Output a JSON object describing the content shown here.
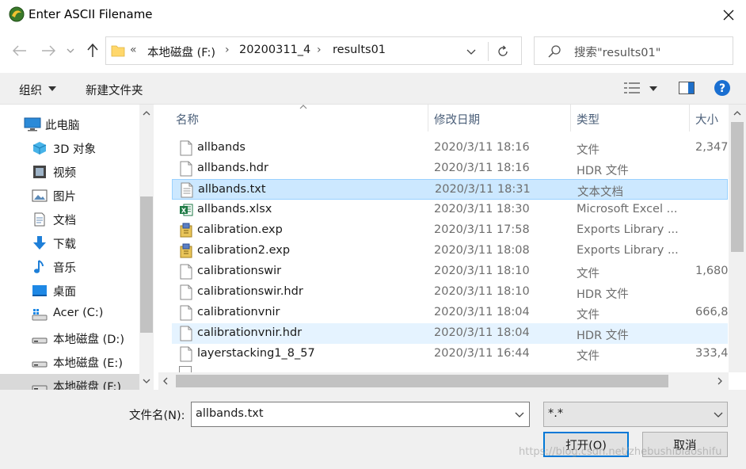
{
  "window": {
    "title": "Enter ASCII Filename",
    "close_icon": "close-icon",
    "app_icon": "idl-app-icon"
  },
  "address": {
    "overflow": "«",
    "crumbs": [
      "本地磁盘 (F:)",
      "20200311_4",
      "results01"
    ],
    "search_placeholder": "搜索\"results01\""
  },
  "toolbar": {
    "organize": "组织",
    "new_folder": "新建文件夹"
  },
  "nav": {
    "items": [
      {
        "label": "此电脑",
        "icon": "computer-icon"
      },
      {
        "label": "3D 对象",
        "icon": "cube-3d-icon"
      },
      {
        "label": "视频",
        "icon": "video-icon"
      },
      {
        "label": "图片",
        "icon": "picture-icon"
      },
      {
        "label": "文档",
        "icon": "document-icon"
      },
      {
        "label": "下载",
        "icon": "download-arrow-icon"
      },
      {
        "label": "音乐",
        "icon": "music-note-icon"
      },
      {
        "label": "桌面",
        "icon": "desktop-icon"
      },
      {
        "label": "Acer (C:)",
        "icon": "windows-drive-icon"
      },
      {
        "label": "本地磁盘 (D:)",
        "icon": "drive-icon"
      },
      {
        "label": "本地磁盘 (E:)",
        "icon": "drive-icon"
      },
      {
        "label": "本地磁盘 (F:)",
        "icon": "drive-icon"
      }
    ]
  },
  "columns": {
    "name": "名称",
    "date": "修改日期",
    "type": "类型",
    "size": "大小"
  },
  "files": [
    {
      "name": "allbands",
      "date": "2020/3/11 18:16",
      "type": "文件",
      "size": "2,347",
      "icon": "file-icon"
    },
    {
      "name": "allbands.hdr",
      "date": "2020/3/11 18:16",
      "type": "HDR 文件",
      "size": "",
      "icon": "file-icon"
    },
    {
      "name": "allbands.txt",
      "date": "2020/3/11 18:31",
      "type": "文本文档",
      "size": "",
      "icon": "text-file-icon"
    },
    {
      "name": "allbands.xlsx",
      "date": "2020/3/11 18:30",
      "type": "Microsoft Excel ...",
      "size": "",
      "icon": "excel-icon"
    },
    {
      "name": "calibration.exp",
      "date": "2020/3/11 17:58",
      "type": "Exports Library ...",
      "size": "",
      "icon": "exports-library-icon"
    },
    {
      "name": "calibration2.exp",
      "date": "2020/3/11 18:08",
      "type": "Exports Library ...",
      "size": "",
      "icon": "exports-library-icon"
    },
    {
      "name": "calibrationswir",
      "date": "2020/3/11 18:10",
      "type": "文件",
      "size": "1,680",
      "icon": "file-icon"
    },
    {
      "name": "calibrationswir.hdr",
      "date": "2020/3/11 18:10",
      "type": "HDR 文件",
      "size": "",
      "icon": "file-icon"
    },
    {
      "name": "calibrationvnir",
      "date": "2020/3/11 18:04",
      "type": "文件",
      "size": "666,8",
      "icon": "file-icon"
    },
    {
      "name": "calibrationvnir.hdr",
      "date": "2020/3/11 18:04",
      "type": "HDR 文件",
      "size": "",
      "icon": "file-icon"
    },
    {
      "name": "layerstacking1_8_57",
      "date": "2020/3/11 16:44",
      "type": "文件",
      "size": "333,4",
      "icon": "file-icon"
    }
  ],
  "bottom": {
    "filename_label": "文件名(N):",
    "filename_value": "allbands.txt",
    "filter_value": "*.*",
    "open_label": "打开(O)",
    "cancel_label": "取消"
  },
  "watermark": "https://blog.csdn.net/zhebushibiaoshifu",
  "colors": {
    "selection": "#cce8ff",
    "hover": "#e5f3ff",
    "accent": "#0078d7"
  }
}
